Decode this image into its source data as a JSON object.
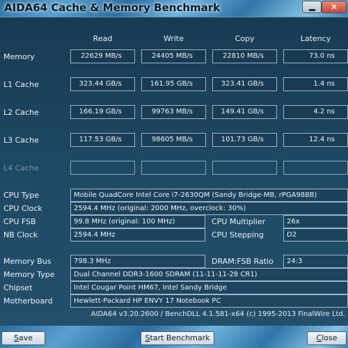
{
  "window": {
    "title": "AIDA64 Cache & Memory Benchmark",
    "close_glyph": "✕"
  },
  "columns": [
    "Read",
    "Write",
    "Copy",
    "Latency"
  ],
  "bench_rows": [
    {
      "label": "Memory",
      "values": [
        "22629 MB/s",
        "24405 MB/s",
        "22810 MB/s",
        "73.0 ns"
      ]
    },
    {
      "label": "L1 Cache",
      "values": [
        "323.44 GB/s",
        "161.95 GB/s",
        "323.41 GB/s",
        "1.4 ns"
      ]
    },
    {
      "label": "L2 Cache",
      "values": [
        "166.19 GB/s",
        "99763 MB/s",
        "149.41 GB/s",
        "4.2 ns"
      ]
    },
    {
      "label": "L3 Cache",
      "values": [
        "117.53 GB/s",
        "98605 MB/s",
        "101.73 GB/s",
        "12.4 ns"
      ]
    },
    {
      "label": "L4 Cache",
      "values": [
        "",
        "",
        "",
        ""
      ]
    }
  ],
  "cpu": {
    "type_label": "CPU Type",
    "type_value": "Mobile QuadCore Intel Core i7-2630QM  (Sandy Bridge-MB, rPGA988B)",
    "clock_label": "CPU Clock",
    "clock_value": "2594.4 MHz  (original: 2000 MHz, overclock: 30%)",
    "fsb_label": "CPU FSB",
    "fsb_value": "99.8 MHz  (original: 100 MHz)",
    "multiplier_label": "CPU Multiplier",
    "multiplier_value": "26x",
    "nb_clock_label": "NB Clock",
    "nb_clock_value": "2594.4 MHz",
    "stepping_label": "CPU Stepping",
    "stepping_value": "D2"
  },
  "memory": {
    "bus_label": "Memory Bus",
    "bus_value": "798.3 MHz",
    "ratio_label": "DRAM:FSB Ratio",
    "ratio_value": "24:3",
    "type_label": "Memory Type",
    "type_value": "Dual Channel DDR3-1600 SDRAM  (11-11-11-28 CR1)",
    "chipset_label": "Chipset",
    "chipset_value": "Intel Cougar Point HM67, Intel Sandy Bridge",
    "motherboard_label": "Motherboard",
    "motherboard_value": "Hewlett-Packard HP ENVY 17 Notebook PC"
  },
  "footer": "AIDA64 v3.20.2600 / BenchDLL 4.1.581-x64  (c) 1995-2013 FinalWire Ltd.",
  "buttons": {
    "save_first": "S",
    "save_rest": "ave",
    "start_first": "S",
    "start_rest": "tart Benchmark",
    "close_first": "C",
    "close_rest": "lose"
  }
}
